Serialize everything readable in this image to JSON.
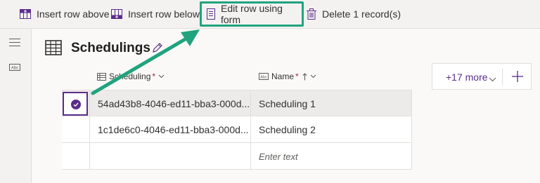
{
  "toolbar": {
    "insert_above_label": "Insert row above",
    "insert_below_label": "Insert row below",
    "edit_form_label": "Edit row using form",
    "delete_label": "Delete 1 record(s)"
  },
  "page": {
    "title": "Schedulings"
  },
  "columns": {
    "scheduling": {
      "label": "Scheduling",
      "required": "*"
    },
    "name": {
      "label": "Name",
      "required": "*"
    }
  },
  "more_columns_label": "+17 more",
  "rows": [
    {
      "scheduling": "54ad43b8-4046-ed11-bba3-000d...",
      "name": "Scheduling 1"
    },
    {
      "scheduling": "1c1de6c0-4046-ed11-bba3-000d...",
      "name": "Scheduling 2"
    },
    {
      "scheduling": "",
      "name_placeholder": "Enter text"
    }
  ],
  "colors": {
    "accent": "#5b2d8a",
    "annotation": "#20a37e",
    "required": "#a4262c"
  }
}
